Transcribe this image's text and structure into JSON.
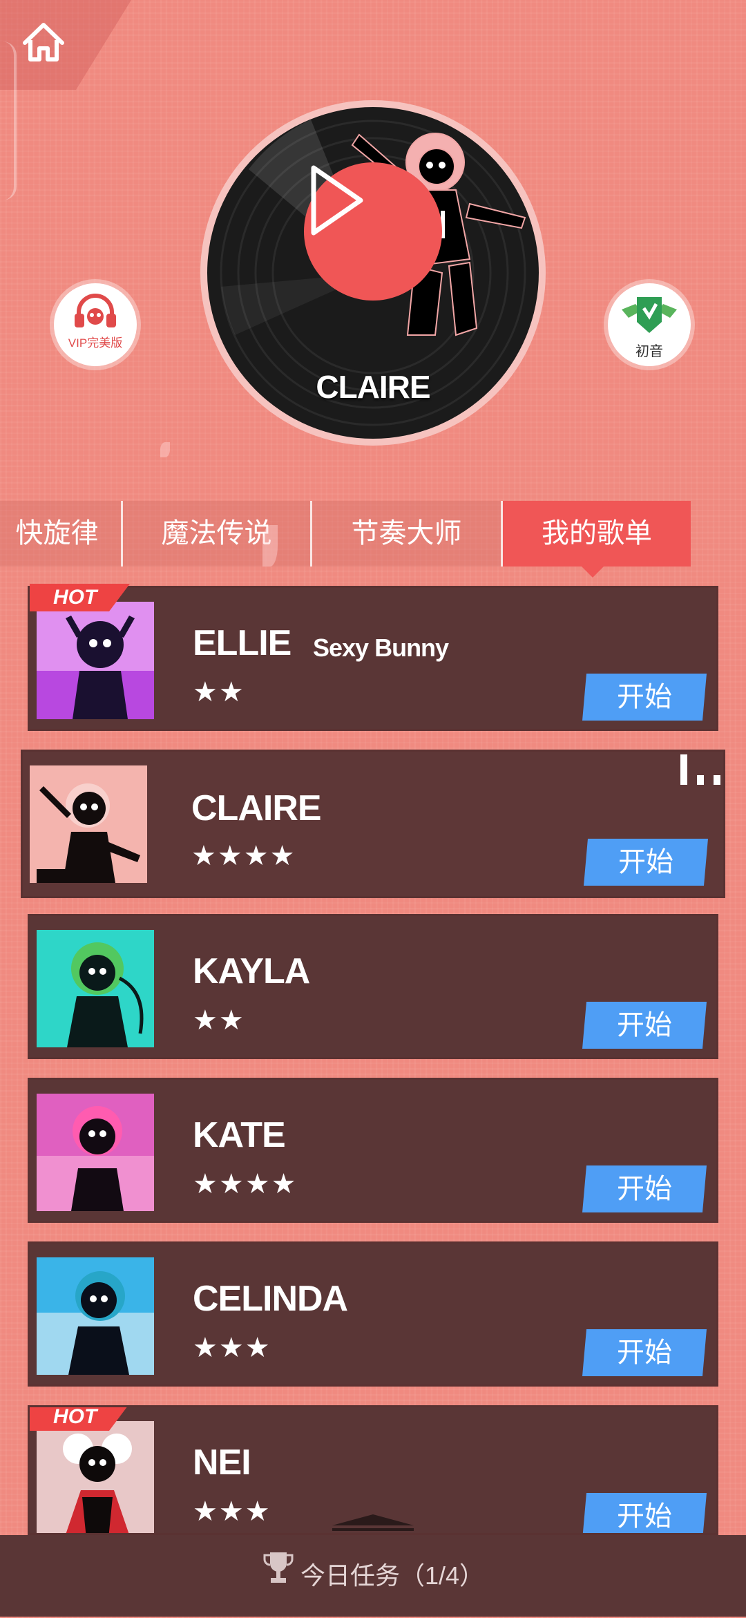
{
  "disc": {
    "title": "CLAIRE"
  },
  "side_buttons": {
    "vip_label": "VIP完美版",
    "miku_label": "初音"
  },
  "tabs": [
    {
      "label": "快旋律",
      "active": false
    },
    {
      "label": "魔法传说",
      "active": false
    },
    {
      "label": "节奏大师",
      "active": false
    },
    {
      "label": "我的歌单",
      "active": true
    }
  ],
  "songs": [
    {
      "name": "ELLIE",
      "subtitle": "Sexy Bunny",
      "stars": "★★",
      "hot": "HOT",
      "action": "开始",
      "cover_colors": [
        "#b848e0",
        "#e090f0"
      ]
    },
    {
      "name": "CLAIRE",
      "subtitle": "",
      "stars": "★★★★",
      "hot": "",
      "action": "开始",
      "cover_colors": [
        "#f6a8a4",
        "#f2c2bc"
      ]
    },
    {
      "name": "KAYLA",
      "subtitle": "",
      "stars": "★★",
      "hot": "",
      "action": "开始",
      "cover_colors": [
        "#2ed6c8",
        "#52c860"
      ]
    },
    {
      "name": "KATE",
      "subtitle": "",
      "stars": "★★★★",
      "hot": "",
      "action": "开始",
      "cover_colors": [
        "#e060c0",
        "#f090d0"
      ]
    },
    {
      "name": "CELINDA",
      "subtitle": "",
      "stars": "★★★",
      "hot": "",
      "action": "开始",
      "cover_colors": [
        "#3ab4e8",
        "#a0d8f0"
      ]
    },
    {
      "name": "NEI",
      "subtitle": "",
      "stars": "★★★",
      "hot": "HOT",
      "action": "开始",
      "cover_colors": [
        "#f0f0f0",
        "#d02830"
      ]
    }
  ],
  "bottom_bar": {
    "label": "今日任务（1/4）"
  },
  "colors": {
    "accent": "#f05656",
    "card_bg": "#5a3636",
    "start_button": "#4f9ef5",
    "background": "#f08a80"
  }
}
